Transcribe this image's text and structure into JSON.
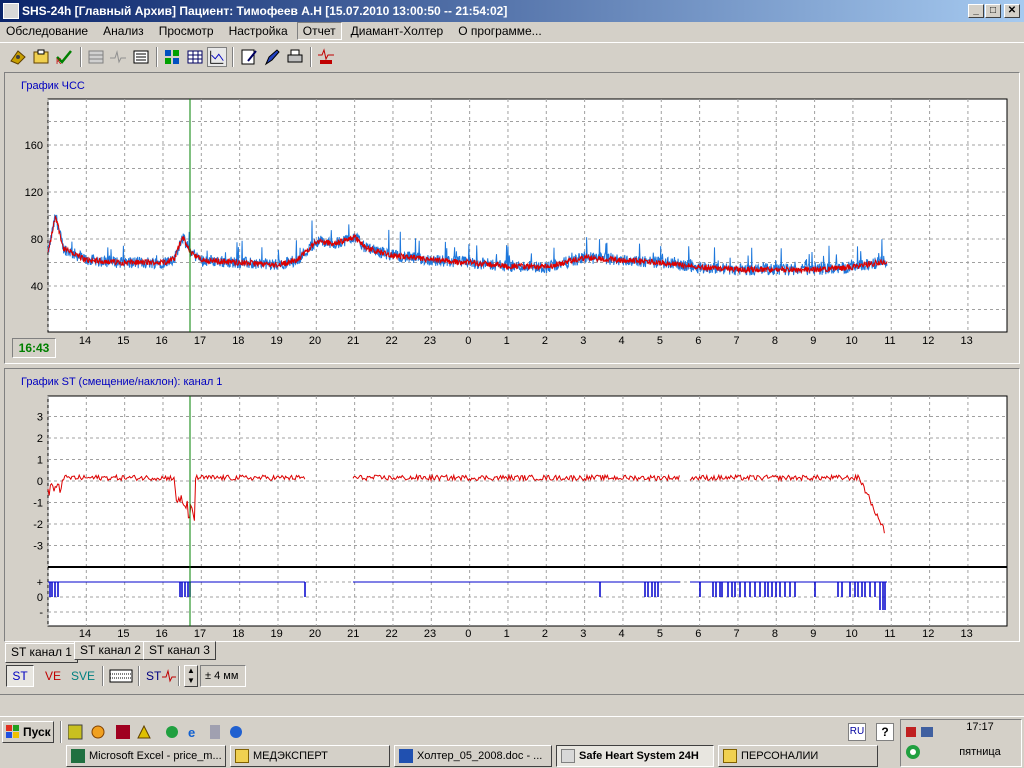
{
  "window": {
    "title": "SHS-24h [Главный Архив] Пациент: Тимофеев А.Н [15.07.2010 13:00:50 -- 21:54:02]",
    "buttons": {
      "minimize": "_",
      "maximize": "□",
      "close": "✕"
    }
  },
  "menu": [
    "Обследование",
    "Анализ",
    "Просмотр",
    "Настройка",
    "Отчет",
    "Диамант-Холтер",
    "О программе..."
  ],
  "hr_chart": {
    "title": "График ЧСС",
    "time_label": "16:43",
    "y_ticks": [
      "160",
      "120",
      "80",
      "40"
    ],
    "x_ticks": [
      "14",
      "15",
      "16",
      "17",
      "18",
      "19",
      "20",
      "21",
      "22",
      "23",
      "0",
      "1",
      "2",
      "3",
      "4",
      "5",
      "6",
      "7",
      "8",
      "9",
      "10",
      "11",
      "12",
      "13"
    ]
  },
  "st_chart": {
    "title": "График ST (смещение/наклон): канал 1",
    "y_ticks": [
      "3",
      "2",
      "1",
      "0",
      "-1",
      "-2",
      "-3"
    ],
    "slope_ticks": [
      "+",
      "0",
      "-"
    ],
    "x_ticks": [
      "14",
      "15",
      "16",
      "17",
      "18",
      "19",
      "20",
      "21",
      "22",
      "23",
      "0",
      "1",
      "2",
      "3",
      "4",
      "5",
      "6",
      "7",
      "8",
      "9",
      "10",
      "11",
      "12",
      "13"
    ]
  },
  "tabs": [
    "ST канал 1",
    "ST канал 2",
    "ST канал 3"
  ],
  "bottom_toolbar": {
    "st": "ST",
    "ve": "VE",
    "sve": "SVE",
    "stcursor": "ST",
    "range": "± 4 мм"
  },
  "taskbar": {
    "start": "Пуск",
    "lang": "RU",
    "help": "?",
    "clock": "17:17",
    "day": "пятница",
    "windows": [
      "Microsoft Excel - price_m...",
      "МЕДЭКСПЕРТ",
      "Холтер_05_2008.doc - ...",
      "Safe Heart System 24H",
      "ПЕРСОНАЛИИ"
    ]
  },
  "colors": {
    "hr_blue": "#1e78dc",
    "hr_red": "#dc0000",
    "st_red": "#dc0000",
    "slope_blue": "#0000cc",
    "cursor": "#008000"
  }
}
